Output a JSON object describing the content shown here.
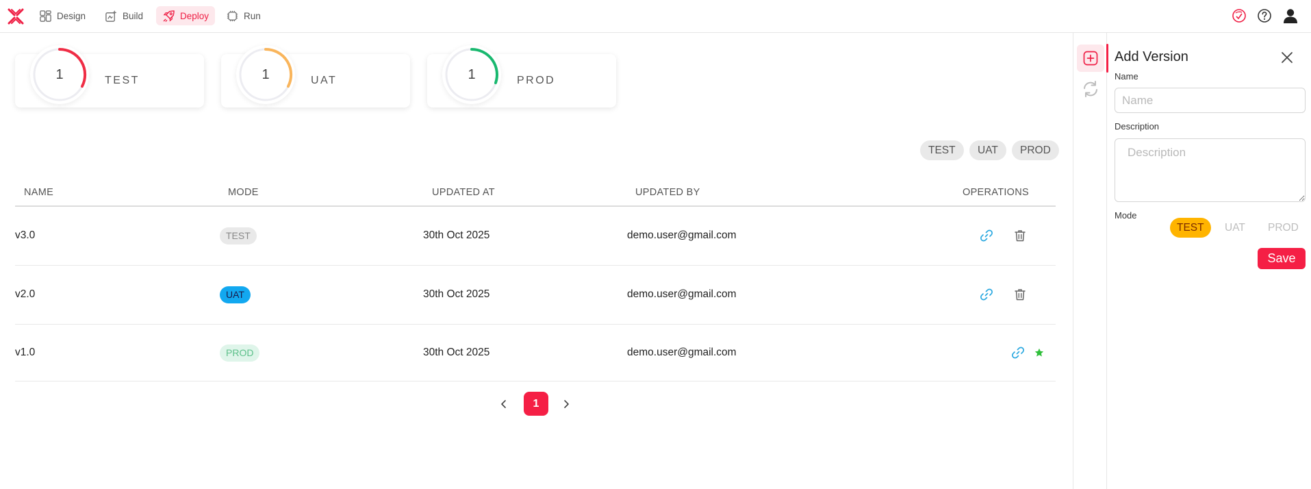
{
  "nav": {
    "items": [
      {
        "label": "Design",
        "icon": "layout-grid-icon"
      },
      {
        "label": "Build",
        "icon": "build-icon"
      },
      {
        "label": "Deploy",
        "icon": "rocket-icon",
        "active": true
      },
      {
        "label": "Run",
        "icon": "run-icon"
      }
    ],
    "right_icons": [
      "deploy-status-icon",
      "help-icon",
      "user-icon"
    ]
  },
  "stats": [
    {
      "label": "TEST",
      "count": "1",
      "color": "#ef2d45"
    },
    {
      "label": "UAT",
      "count": "1",
      "color": "#f9b55c"
    },
    {
      "label": "PROD",
      "count": "1",
      "color": "#19b86f"
    }
  ],
  "filters": [
    "TEST",
    "UAT",
    "PROD"
  ],
  "table": {
    "columns": [
      "NAME",
      "MODE",
      "UPDATED AT",
      "UPDATED BY",
      "OPERATIONS"
    ],
    "rows": [
      {
        "name": "v3.0",
        "mode": "TEST",
        "updated_at": "30th Oct 2025",
        "updated_by": "demo.user@gmail.com",
        "ops": [
          "link-icon",
          "trash-icon"
        ]
      },
      {
        "name": "v2.0",
        "mode": "UAT",
        "updated_at": "30th Oct 2025",
        "updated_by": "demo.user@gmail.com",
        "ops": [
          "link-icon",
          "trash-icon"
        ]
      },
      {
        "name": "v1.0",
        "mode": "PROD",
        "updated_at": "30th Oct 2025",
        "updated_by": "demo.user@gmail.com",
        "ops": [
          "link-icon",
          "star-icon"
        ]
      }
    ]
  },
  "pagination": {
    "current": "1"
  },
  "colors": {
    "accent": "#f51f45",
    "test_badge_bg": "#e9e9e9",
    "uat_badge_bg": "#12a8f0",
    "prod_badge_bg": "#dff5ea",
    "selected_mode_bg": "#ffb400",
    "link_icon": "#2aa8e0",
    "star_icon": "#2fbf3a"
  },
  "panel": {
    "title": "Add Version",
    "name_label": "Name",
    "name_placeholder": "Name",
    "description_label": "Description",
    "description_placeholder": "Description",
    "mode_label": "Mode",
    "modes": [
      "TEST",
      "UAT",
      "PROD"
    ],
    "selected_mode": "TEST",
    "save_label": "Save"
  }
}
